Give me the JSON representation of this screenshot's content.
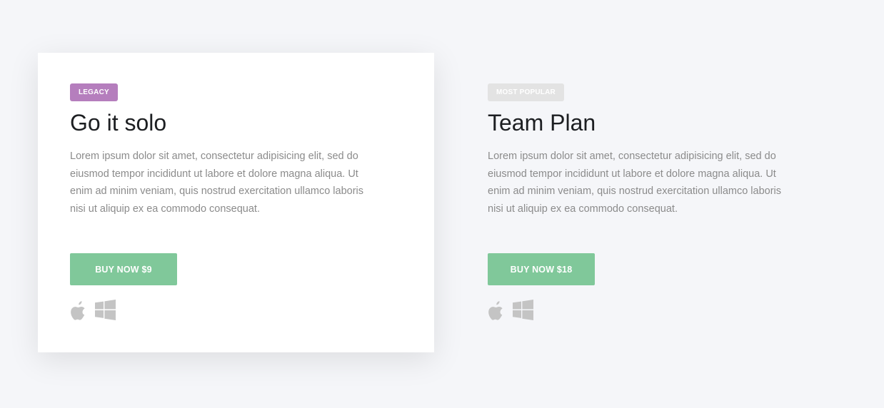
{
  "colors": {
    "page_background": "#f5f6f9",
    "legacy_badge": "#b57ebd",
    "popular_badge": "#e3e3e3",
    "button": "#80c89a",
    "icon": "#c4c4c4"
  },
  "plans": [
    {
      "badge": "LEGACY",
      "title": "Go it solo",
      "description": "Lorem ipsum dolor sit amet, consectetur adipisicing elit, sed do eiusmod tempor incididunt ut labore et dolore magna aliqua. Ut enim ad minim veniam, quis nostrud exercitation ullamco laboris nisi ut aliquip ex ea commodo consequat.",
      "button_label": "BUY NOW $9",
      "platform_icons": [
        "apple-icon",
        "windows-icon"
      ]
    },
    {
      "badge": "MOST POPULAR",
      "title": "Team Plan",
      "description": "Lorem ipsum dolor sit amet, consectetur adipisicing elit, sed do eiusmod tempor incididunt ut labore et dolore magna aliqua. Ut enim ad minim veniam, quis nostrud exercitation ullamco laboris nisi ut aliquip ex ea commodo consequat.",
      "button_label": "BUY NOW $18",
      "platform_icons": [
        "apple-icon",
        "windows-icon"
      ]
    }
  ]
}
